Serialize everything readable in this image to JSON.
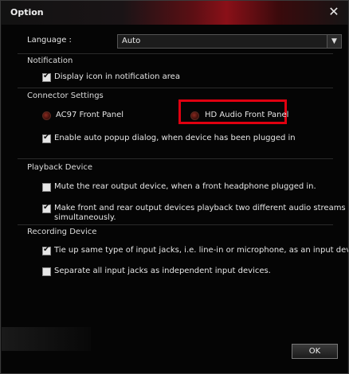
{
  "window": {
    "title": "Option"
  },
  "language": {
    "label": "Language :",
    "value": "Auto"
  },
  "notification": {
    "heading": "Notification",
    "show_icon": {
      "label": "Display icon in notification area",
      "checked": true
    }
  },
  "connector": {
    "heading": "Connector Settings",
    "ac97": {
      "label": "AC97 Front Panel",
      "selected": false
    },
    "hd_audio": {
      "label": "HD Audio Front Panel",
      "selected": true
    },
    "auto_popup": {
      "label": "Enable auto popup dialog, when device has been plugged in",
      "checked": true
    }
  },
  "playback": {
    "heading": "Playback Device",
    "mute_rear": {
      "label": "Mute the rear output device, when a front headphone plugged in.",
      "checked": false
    },
    "two_streams": {
      "line1": "Make front and rear output devices playback two different audio streams",
      "line2": "simultaneously.",
      "checked": true
    }
  },
  "recording": {
    "heading": "Recording Device",
    "tie_up": {
      "label": "Tie up same type of input jacks, i.e. line-in or microphone, as an input device.",
      "checked": true
    },
    "separate": {
      "label": "Separate all input jacks as independent input devices.",
      "checked": false
    }
  },
  "buttons": {
    "ok": "OK"
  },
  "colors": {
    "highlight": "#e00010",
    "title_gradient": "#8a1018"
  }
}
